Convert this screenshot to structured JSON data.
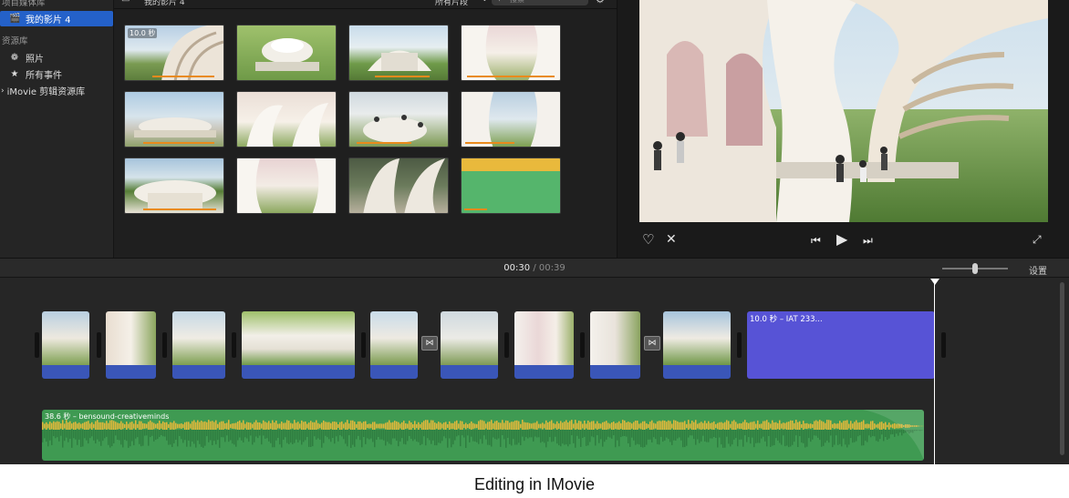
{
  "sidebar": {
    "project_section": "项目媒体库",
    "project_item": "我的影片 4",
    "library_section": "资源库",
    "items": [
      {
        "icon": "photos-icon",
        "label": "照片"
      },
      {
        "icon": "star-icon",
        "label": "所有事件"
      },
      {
        "icon": "chevron-right-icon",
        "label": "iMovie 剪辑资源库"
      }
    ]
  },
  "browser": {
    "title": "我的影片 4",
    "filter": "所有片段",
    "search_placeholder": "搜索",
    "first_clip_duration": "10.0 秒",
    "clips": [
      {
        "kind": "arches"
      },
      {
        "kind": "pavilion-top"
      },
      {
        "kind": "pavilion-people"
      },
      {
        "kind": "arches-close"
      },
      {
        "kind": "plaza"
      },
      {
        "kind": "arches-inside"
      },
      {
        "kind": "crowd"
      },
      {
        "kind": "interior"
      },
      {
        "kind": "pavilion-front"
      },
      {
        "kind": "arches-pink"
      },
      {
        "kind": "arches-dark"
      },
      {
        "kind": "green-title"
      }
    ]
  },
  "viewer": {
    "controls": [
      "heart-icon",
      "reject-icon",
      "skip-back-icon",
      "play-icon",
      "skip-forward-icon",
      "fullscreen-icon"
    ]
  },
  "timeline_header": {
    "current_time": "00:30",
    "separator": "/",
    "total_time": "00:39",
    "settings_label": "设置"
  },
  "timeline": {
    "title_clip_label": "10.0 秒 – IAT 233...",
    "audio_clip_label": "38.6 秒 – bensound-creativeminds"
  },
  "caption": "Editing in IMovie",
  "colors": {
    "selection": "#2461c9",
    "clip_blue": "#3a56b8",
    "title_clip": "#5753d6",
    "audio_green": "#3f9a52",
    "waveform_yellow": "#e4b83a"
  }
}
